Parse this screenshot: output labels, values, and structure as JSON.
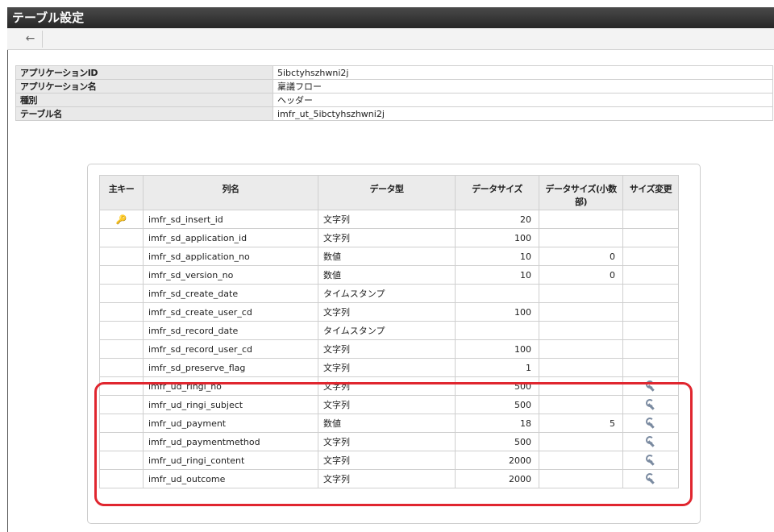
{
  "window": {
    "title": "テーブル設定"
  },
  "toolbar": {
    "back_icon": "back-arrow-icon"
  },
  "info": [
    {
      "label": "アプリケーションID",
      "value": "5ibctyhszhwni2j"
    },
    {
      "label": "アプリケーション名",
      "value": "稟議フロー"
    },
    {
      "label": "種別",
      "value": "ヘッダー"
    },
    {
      "label": "テーブル名",
      "value": "imfr_ut_5ibctyhszhwni2j"
    }
  ],
  "columns_table": {
    "headers": [
      "主キー",
      "列名",
      "データ型",
      "データサイズ",
      "データサイズ(小数部)",
      "サイズ変更"
    ],
    "rows": [
      {
        "pk": "key-icon",
        "name": "imfr_sd_insert_id",
        "type": "文字列",
        "size": "20",
        "scale": "",
        "edit": ""
      },
      {
        "pk": "",
        "name": "imfr_sd_application_id",
        "type": "文字列",
        "size": "100",
        "scale": "",
        "edit": ""
      },
      {
        "pk": "",
        "name": "imfr_sd_application_no",
        "type": "数値",
        "size": "10",
        "scale": "0",
        "edit": ""
      },
      {
        "pk": "",
        "name": "imfr_sd_version_no",
        "type": "数値",
        "size": "10",
        "scale": "0",
        "edit": ""
      },
      {
        "pk": "",
        "name": "imfr_sd_create_date",
        "type": "タイムスタンプ",
        "size": "",
        "scale": "",
        "edit": ""
      },
      {
        "pk": "",
        "name": "imfr_sd_create_user_cd",
        "type": "文字列",
        "size": "100",
        "scale": "",
        "edit": ""
      },
      {
        "pk": "",
        "name": "imfr_sd_record_date",
        "type": "タイムスタンプ",
        "size": "",
        "scale": "",
        "edit": ""
      },
      {
        "pk": "",
        "name": "imfr_sd_record_user_cd",
        "type": "文字列",
        "size": "100",
        "scale": "",
        "edit": ""
      },
      {
        "pk": "",
        "name": "imfr_sd_preserve_flag",
        "type": "文字列",
        "size": "1",
        "scale": "",
        "edit": ""
      },
      {
        "pk": "",
        "name": "imfr_ud_ringi_no",
        "type": "文字列",
        "size": "500",
        "scale": "",
        "edit": "wrench-icon"
      },
      {
        "pk": "",
        "name": "imfr_ud_ringi_subject",
        "type": "文字列",
        "size": "500",
        "scale": "",
        "edit": "wrench-icon"
      },
      {
        "pk": "",
        "name": "imfr_ud_payment",
        "type": "数値",
        "size": "18",
        "scale": "5",
        "edit": "wrench-icon"
      },
      {
        "pk": "",
        "name": "imfr_ud_paymentmethod",
        "type": "文字列",
        "size": "500",
        "scale": "",
        "edit": "wrench-icon"
      },
      {
        "pk": "",
        "name": "imfr_ud_ringi_content",
        "type": "文字列",
        "size": "2000",
        "scale": "",
        "edit": "wrench-icon"
      },
      {
        "pk": "",
        "name": "imfr_ud_outcome",
        "type": "文字列",
        "size": "2000",
        "scale": "",
        "edit": "wrench-icon"
      }
    ]
  },
  "colors": {
    "highlight": "#e0262f",
    "titlebar": "#333333"
  }
}
